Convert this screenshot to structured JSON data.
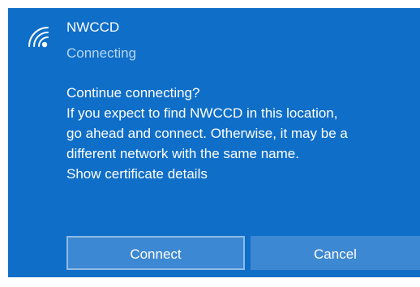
{
  "network": {
    "name": "NWCCD",
    "status": "Connecting",
    "icon": "wifi-secured-icon"
  },
  "prompt": {
    "question": "Continue connecting?",
    "lines": [
      "If you expect to find NWCCD in this location,",
      "go ahead and connect. Otherwise, it may be a",
      "different network with the same name."
    ],
    "link": "Show certificate details"
  },
  "buttons": {
    "connect_label": "Connect",
    "cancel_label": "Cancel"
  },
  "colors": {
    "panel_background": "#0f6ec8",
    "button_background": "#3d88d2",
    "focus_border": "#8ebbe6",
    "secondary_text": "#b9d6f2"
  }
}
